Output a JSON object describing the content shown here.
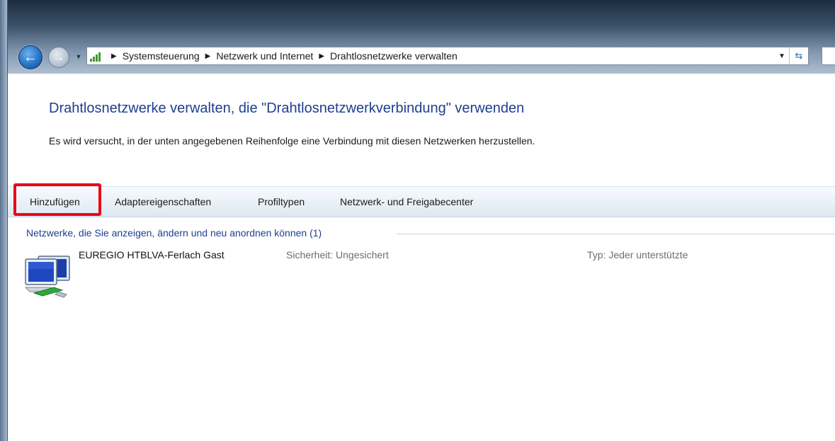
{
  "navigation": {
    "back_icon": "back-arrow-icon",
    "forward_icon": "forward-arrow-icon",
    "address_icon": "network-signal-icon",
    "breadcrumbs": [
      "Systemsteuerung",
      "Netzwerk und Internet",
      "Drahtlosnetzwerke verwalten"
    ],
    "refresh_icon": "refresh-icon"
  },
  "page": {
    "title": "Drahtlosnetzwerke verwalten, die \"Drahtlosnetzwerkverbindung\" verwenden",
    "description": "Es wird versucht, in der unten angegebenen Reihenfolge eine Verbindung mit diesen Netzwerken herzustellen."
  },
  "toolbar": {
    "add_label": "Hinzufügen",
    "adapter_label": "Adaptereigenschaften",
    "profile_label": "Profiltypen",
    "network_center_label": "Netzwerk- und Freigabecenter"
  },
  "highlight_color": "#e8071a",
  "networks_group": {
    "header": "Netzwerke, die Sie anzeigen, ändern und neu anordnen können (1)",
    "items": [
      {
        "name": "EUREGIO HTBLVA-Ferlach Gast",
        "security": "Sicherheit: Ungesichert",
        "type": "Typ: Jeder unterstützte",
        "icon": "wireless-network-icon"
      }
    ]
  }
}
